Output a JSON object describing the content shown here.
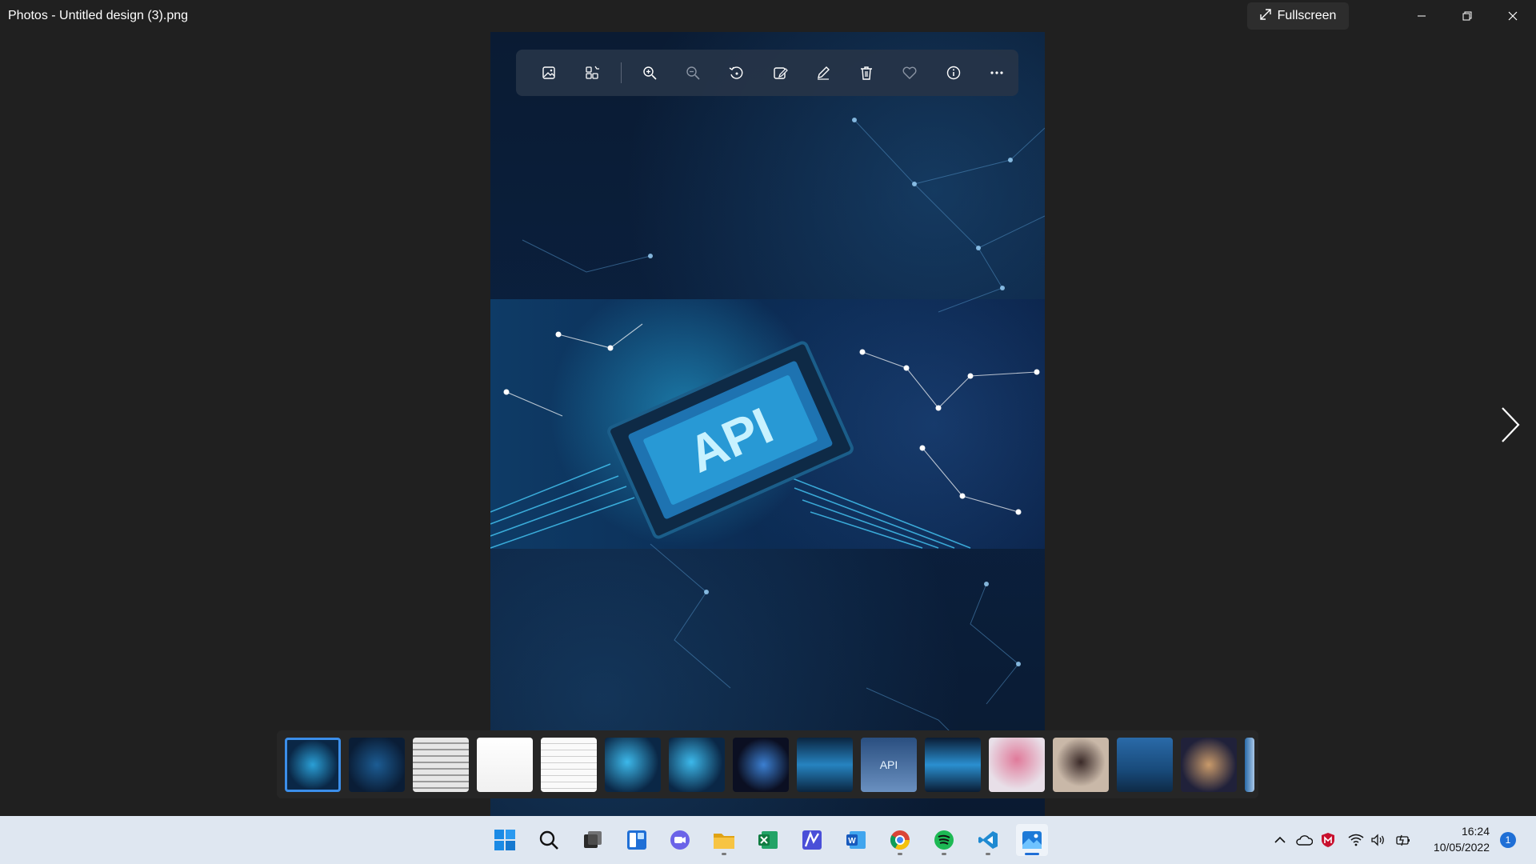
{
  "window": {
    "title": "Photos - Untitled design (3).png",
    "fullscreen_label": "Fullscreen"
  },
  "photo": {
    "chip_text": "API"
  },
  "toolbar": {
    "tools": [
      "image-icon",
      "gallery-icon",
      "zoom-in-icon",
      "zoom-out-icon",
      "rotate-icon",
      "edit-image-icon",
      "draw-icon",
      "delete-icon",
      "favorite-icon",
      "info-icon",
      "more-icon"
    ]
  },
  "filmstrip": {
    "selected_index": 0,
    "thumb_11_label": "API"
  },
  "taskbar": {
    "apps": [
      "start",
      "search",
      "task-view",
      "widgets",
      "chat",
      "file-explorer",
      "excel",
      "app",
      "word",
      "chrome",
      "spotify",
      "vscode",
      "photos"
    ],
    "time": "16:24",
    "date": "10/05/2022",
    "notification_count": "1"
  },
  "colors": {
    "accent": "#3b8eea",
    "taskbar": "#dfe7f1",
    "background": "#202020"
  }
}
